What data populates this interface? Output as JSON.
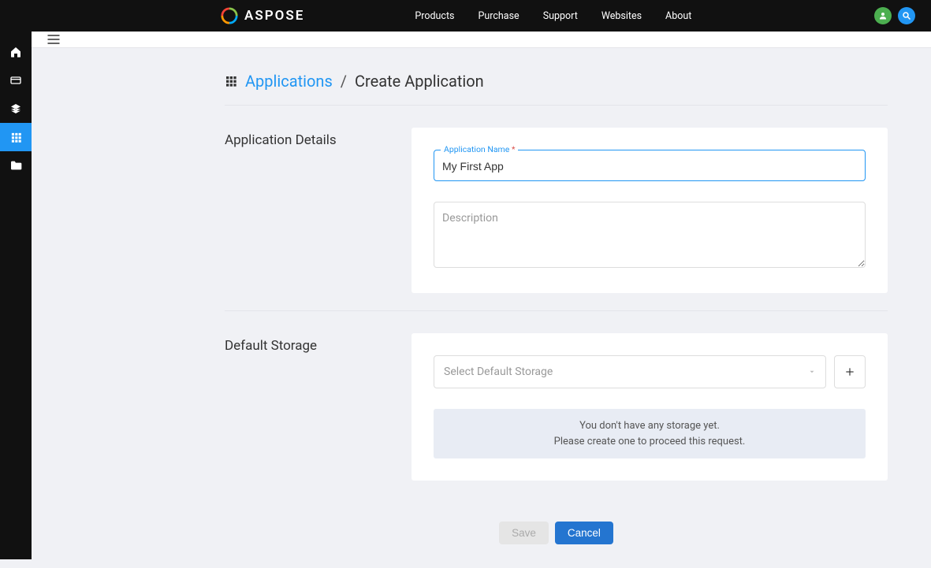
{
  "header": {
    "brand": "ASPOSE",
    "nav": [
      "Products",
      "Purchase",
      "Support",
      "Websites",
      "About"
    ]
  },
  "breadcrumb": {
    "link": "Applications",
    "sep": "/",
    "current": "Create Application"
  },
  "sections": {
    "details": {
      "title": "Application Details",
      "name_label": "Application Name",
      "name_required_mark": "*",
      "name_value": "My First App",
      "description_placeholder": "Description"
    },
    "storage": {
      "title": "Default Storage",
      "select_placeholder": "Select Default Storage",
      "info_line1": "You don't have any storage yet.",
      "info_line2": "Please create one to proceed this request."
    }
  },
  "actions": {
    "save": "Save",
    "cancel": "Cancel"
  }
}
